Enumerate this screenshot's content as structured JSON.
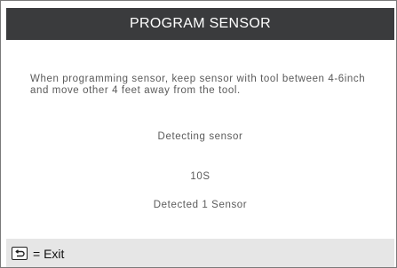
{
  "header": {
    "title": "PROGRAM SENSOR"
  },
  "main": {
    "instructions": "When programming sensor, keep sensor with tool between 4-6inch and move other 4 feet away from the tool.",
    "status": "Detecting sensor",
    "countdown": "10S",
    "result": "Detected 1 Sensor"
  },
  "footer": {
    "exit_icon": "return-icon",
    "exit_label": "= Exit"
  }
}
